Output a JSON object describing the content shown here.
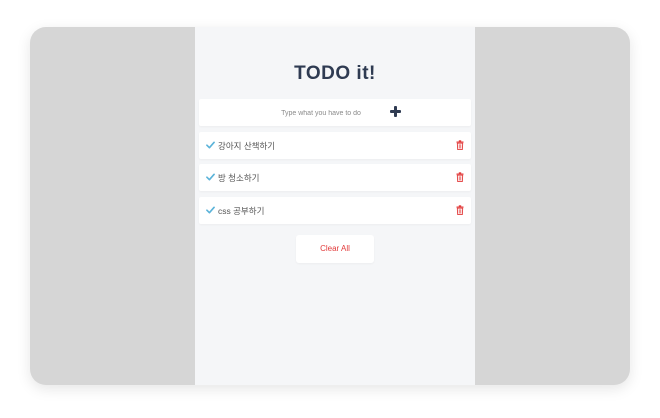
{
  "app": {
    "title": "TODO it!",
    "input": {
      "value": "",
      "placeholder": "Type what you have to do"
    },
    "add_icon": "plus-icon",
    "todos": [
      {
        "text": "강아지 산책하기",
        "check_icon": "check-icon",
        "delete_icon": "trash-icon"
      },
      {
        "text": "방 청소하기",
        "check_icon": "check-icon",
        "delete_icon": "trash-icon"
      },
      {
        "text": "css 공부하기",
        "check_icon": "check-icon",
        "delete_icon": "trash-icon"
      }
    ],
    "clear_all_label": "Clear All"
  },
  "colors": {
    "background": "#d6d6d6",
    "app_background": "#f5f6f8",
    "title": "#2f3b52",
    "check": "#5bb3d9",
    "delete": "#e23a3a"
  }
}
